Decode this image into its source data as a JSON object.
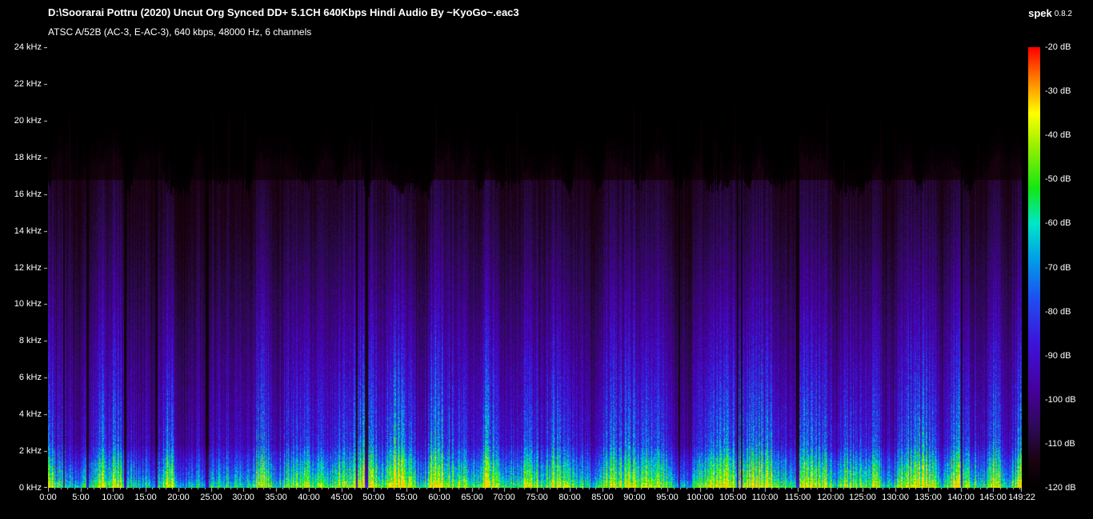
{
  "window": {
    "title": "D:\\Soorarai Pottru (2020) Uncut Org Synced DD+ 5.1CH 640Kbps Hindi Audio By ~KyoGo~.eac3",
    "app_name": "spek",
    "app_version": "0.8.2",
    "subtitle": "ATSC A/52B (AC-3, E-AC-3), 640 kbps, 48000 Hz, 6 channels"
  },
  "chart_data": {
    "type": "heatmap",
    "title": "D:\\Soorarai Pottru (2020) Uncut Org Synced DD+ 5.1CH 640Kbps Hindi Audio By ~KyoGo~.eac3",
    "subtitle": "ATSC A/52B (AC-3, E-AC-3), 640 kbps, 48000 Hz, 6 channels",
    "x_axis": {
      "unit": "time",
      "total_seconds": 8962,
      "tick_labels": [
        "0:00",
        "5:00",
        "10:00",
        "15:00",
        "20:00",
        "25:00",
        "30:00",
        "35:00",
        "40:00",
        "45:00",
        "50:00",
        "55:00",
        "60:00",
        "65:00",
        "70:00",
        "75:00",
        "80:00",
        "85:00",
        "90:00",
        "95:00",
        "100:00",
        "105:00",
        "110:00",
        "115:00",
        "120:00",
        "125:00",
        "130:00",
        "135:00",
        "140:00",
        "145:00",
        "149:22"
      ]
    },
    "y_axis": {
      "unit": "frequency",
      "min_khz": 0,
      "max_khz": 24,
      "tick_labels": [
        "24 kHz",
        "22 kHz",
        "20 kHz",
        "18 kHz",
        "16 kHz",
        "14 kHz",
        "12 kHz",
        "10 kHz",
        "8 kHz",
        "6 kHz",
        "4 kHz",
        "2 kHz",
        "0 kHz"
      ]
    },
    "colorbar": {
      "max_db": -20,
      "min_db": -120,
      "tick_labels": [
        "-20 dB",
        "-30 dB",
        "-40 dB",
        "-50 dB",
        "-60 dB",
        "-70 dB",
        "-80 dB",
        "-90 dB",
        "-100 dB",
        "-110 dB",
        "-120 dB"
      ]
    },
    "palette_stops": [
      {
        "t": 0.0,
        "color": "#000000"
      },
      {
        "t": 0.06,
        "color": "#1a0210"
      },
      {
        "t": 0.13,
        "color": "#2b0a50"
      },
      {
        "t": 0.22,
        "color": "#46009c"
      },
      {
        "t": 0.33,
        "color": "#3c14dc"
      },
      {
        "t": 0.43,
        "color": "#1e50f0"
      },
      {
        "t": 0.52,
        "color": "#00a0e6"
      },
      {
        "t": 0.6,
        "color": "#00e6c8"
      },
      {
        "t": 0.68,
        "color": "#14e614"
      },
      {
        "t": 0.78,
        "color": "#a0f000"
      },
      {
        "t": 0.85,
        "color": "#ffff00"
      },
      {
        "t": 0.92,
        "color": "#ff8c00"
      },
      {
        "t": 1.0,
        "color": "#ff0000"
      }
    ],
    "spectral_content": {
      "seed": 1337,
      "typical_cutoff_khz": 17,
      "spike_cutoff_khz": 20.3,
      "description": "Dense blue/violet vertical streaks reaching ~17 kHz with sparse narrow spikes to ~20.3 kHz; bright green/cyan low-frequency energy band below ~2 kHz; black above cutoff."
    }
  }
}
